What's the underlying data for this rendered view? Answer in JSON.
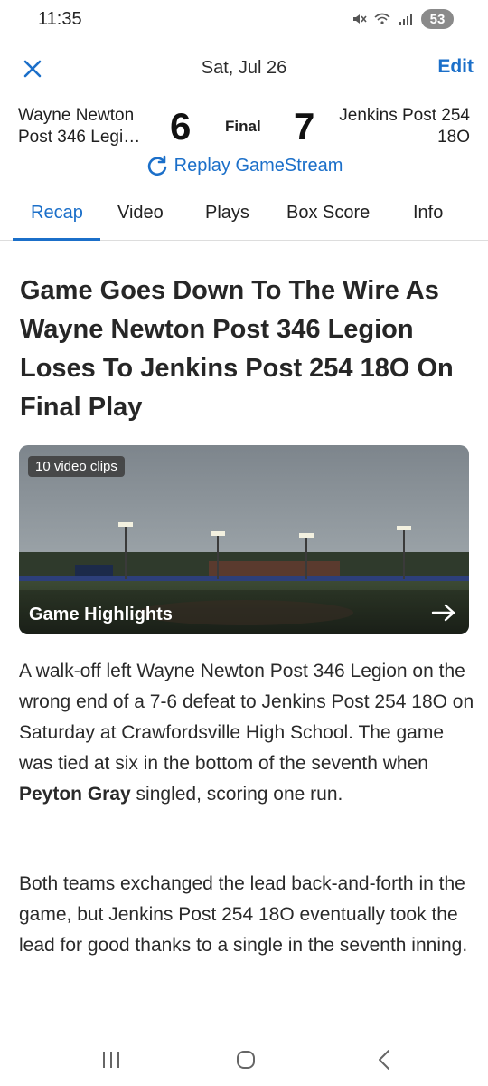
{
  "status_bar": {
    "time": "11:35",
    "battery": "53"
  },
  "header": {
    "date": "Sat, Jul 26",
    "edit_label": "Edit"
  },
  "score": {
    "home_team": "Wayne Newton Post 346 Legi…",
    "home_score": "6",
    "status": "Final",
    "away_score": "7",
    "away_team": "Jenkins Post 254 18O",
    "replay_label": "Replay GameStream"
  },
  "tabs": [
    {
      "label": "Recap"
    },
    {
      "label": "Video"
    },
    {
      "label": "Plays"
    },
    {
      "label": "Box Score"
    },
    {
      "label": "Info"
    }
  ],
  "recap": {
    "headline": "Game Goes Down To The Wire As Wayne Newton Post 346 Legion Loses To Jenkins Post 254 18O On Final Play",
    "video": {
      "clips_badge": "10 video clips",
      "label": "Game Highlights"
    },
    "para1_before": "A walk-off left Wayne Newton Post 346 Legion on the wrong end of a 7-6 defeat to Jenkins Post 254 18O on Saturday at Crawfordsville High School. The game was tied at six in the bottom of the seventh when ",
    "para1_player": "Peyton Gray",
    "para1_after": " singled, scoring one run.",
    "para2": "Both teams exchanged the lead back-and-forth in the game, but Jenkins Post 254 18O eventually took the lead for good thanks to a single in the seventh inning."
  },
  "colors": {
    "accent": "#1b6fc9"
  }
}
